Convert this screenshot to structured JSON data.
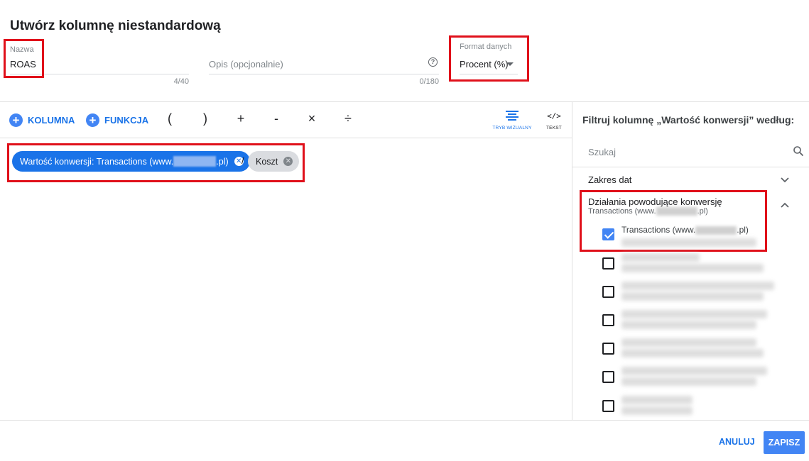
{
  "dialog": {
    "title": "Utwórz kolumnę niestandardową"
  },
  "fields": {
    "name": {
      "label": "Nazwa",
      "value": "ROAS",
      "counter": "4/40"
    },
    "description": {
      "placeholder": "Opis (opcjonalnie)",
      "counter": "0/180",
      "help_icon": "help-circle-icon"
    },
    "format": {
      "label": "Format danych",
      "value": "Procent (%)"
    }
  },
  "toolbar": {
    "column_label": "KOLUMNA",
    "function_label": "FUNKCJA",
    "operators": [
      "(",
      ")",
      "+",
      "-",
      "×",
      "÷"
    ],
    "visual_mode_label": "TRYB WIZUALNY",
    "text_mode_label": "TEKST",
    "text_mode_code": "</>"
  },
  "formula": {
    "chip1_prefix": "Wartość konwersji: Transactions (www.",
    "chip1_suffix": ".pl)",
    "separator": "/",
    "chip2_label": "Koszt"
  },
  "panel": {
    "title": "Filtruj kolumnę „Wartość konwersji” według:",
    "search_placeholder": "Szukaj",
    "date_range_label": "Zakres dat",
    "conversions_label": "Działania powodujące konwersję",
    "conversions_sub_prefix": "Transactions (www.",
    "conversions_sub_suffix": ".pl)",
    "option_prefix": "Transactions (www.",
    "option_suffix": ".pl)"
  },
  "footer": {
    "cancel_label": "ANULUJ",
    "save_label": "ZAPISZ"
  },
  "colors": {
    "accent": "#1a73e8",
    "highlight": "#e0101a",
    "chip_grey": "#dadce0"
  }
}
